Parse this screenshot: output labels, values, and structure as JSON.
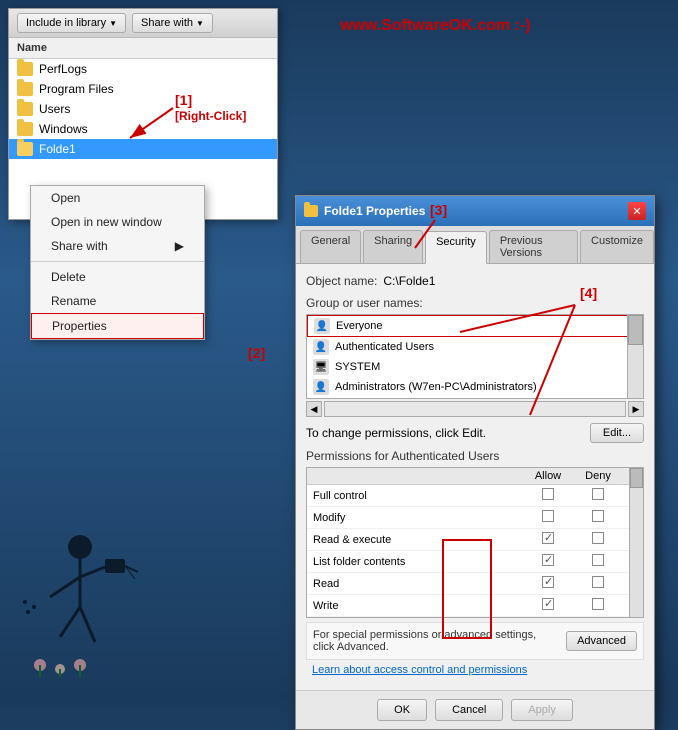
{
  "watermark": {
    "text": "www.SoftwareOK.com :-)"
  },
  "explorer": {
    "toolbar": {
      "include_library": "Include in library",
      "share_with": "Share with"
    },
    "header": {
      "name_col": "Name"
    },
    "items": [
      {
        "label": "PerfLogs"
      },
      {
        "label": "Program Files"
      },
      {
        "label": "Users"
      },
      {
        "label": "Windows"
      },
      {
        "label": "Folde1"
      }
    ]
  },
  "context_menu": {
    "items": [
      {
        "label": "Open",
        "separator_after": false
      },
      {
        "label": "Open in new window",
        "separator_after": false
      },
      {
        "label": "Share with",
        "separator_after": true,
        "has_submenu": true
      },
      {
        "label": "Delete",
        "separator_after": false
      },
      {
        "label": "Rename",
        "separator_after": false
      },
      {
        "label": "Properties",
        "separator_after": false,
        "highlighted": true
      }
    ]
  },
  "annotations": {
    "label1": "[1]",
    "label2": "[2]",
    "label3": "[3]",
    "label4": "[4]",
    "right_click": "[Right-Click]"
  },
  "properties_dialog": {
    "title": "Folde1 Properties",
    "tabs": [
      {
        "label": "General"
      },
      {
        "label": "Sharing"
      },
      {
        "label": "Security",
        "active": true
      },
      {
        "label": "Previous Versions"
      },
      {
        "label": "Customize"
      }
    ],
    "object_name_label": "Object name:",
    "object_name_value": "C:\\Folde1",
    "group_label": "Group or user names:",
    "users": [
      {
        "label": "Everyone",
        "highlighted": true
      },
      {
        "label": "Authenticated Users"
      },
      {
        "label": "SYSTEM"
      },
      {
        "label": "Administrators (W7en-PC\\Administrators)"
      }
    ],
    "change_perms_text": "To change permissions, click Edit.",
    "edit_btn": "Edit...",
    "perms_label": "Permissions for Authenticated Users",
    "perms_columns": {
      "name": "",
      "allow": "Allow",
      "deny": "Deny"
    },
    "permissions": [
      {
        "name": "Full control",
        "allow": false,
        "deny": false
      },
      {
        "name": "Modify",
        "allow": false,
        "deny": false
      },
      {
        "name": "Read & execute",
        "allow": true,
        "deny": false
      },
      {
        "name": "List folder contents",
        "allow": true,
        "deny": false
      },
      {
        "name": "Read",
        "allow": true,
        "deny": false
      },
      {
        "name": "Write",
        "allow": true,
        "deny": false
      }
    ],
    "special_perms_text": "For special permissions or advanced settings, click Advanced.",
    "advanced_btn": "Advanced",
    "learn_link": "Learn about access control and permissions",
    "footer": {
      "ok": "OK",
      "cancel": "Cancel",
      "apply": "Apply"
    }
  }
}
